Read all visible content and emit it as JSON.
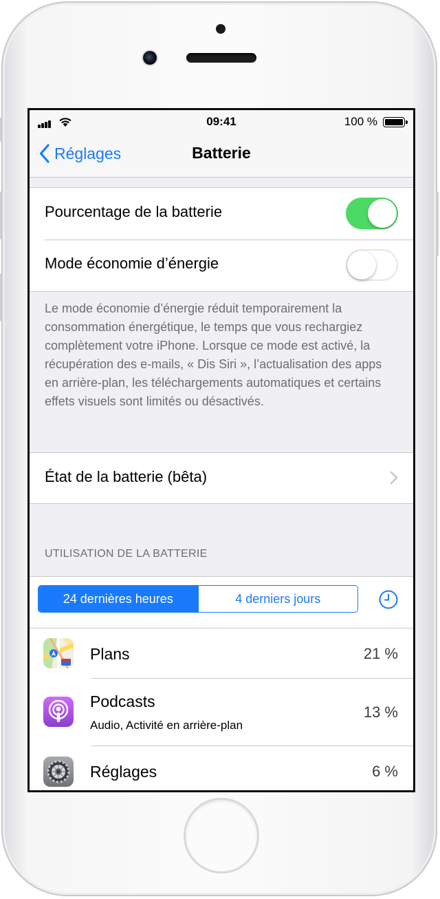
{
  "status_bar": {
    "time": "09:41",
    "battery_percent_text": "100 %"
  },
  "nav": {
    "back_label": "Réglages",
    "title": "Batterie"
  },
  "settings": {
    "battery_percentage": {
      "label": "Pourcentage de la batterie",
      "enabled": true
    },
    "low_power_mode": {
      "label": "Mode économie d’énergie",
      "enabled": false
    },
    "low_power_footnote": "Le mode économie d’énergie réduit temporairement la consommation énergétique, le temps que vous rechargiez complètement votre iPhone. Lorsque ce mode est activé, la récupération des e-mails, « Dis Siri », l’actualisation des apps en arrière-plan, les téléchargements automatiques et certains effets visuels sont limités ou désactivés.",
    "battery_health": {
      "label": "État de la batterie (bêta)"
    }
  },
  "usage": {
    "section_header": "UTILISATION DE LA BATTERIE",
    "segments": [
      {
        "label": "24 dernières heures",
        "selected": true
      },
      {
        "label": "4 derniers jours",
        "selected": false
      }
    ],
    "apps": [
      {
        "name": "Plans",
        "subtitle": "",
        "percent": "21 %",
        "icon": "maps-app-icon"
      },
      {
        "name": "Podcasts",
        "subtitle": "Audio, Activité en arrière-plan",
        "percent": "13 %",
        "icon": "podcasts-app-icon"
      },
      {
        "name": "Réglages",
        "subtitle": "",
        "percent": "6 %",
        "icon": "settings-app-icon"
      }
    ]
  },
  "colors": {
    "accent": "#1a7afc",
    "toggle_on": "#4cd964",
    "background": "#efeff4"
  }
}
